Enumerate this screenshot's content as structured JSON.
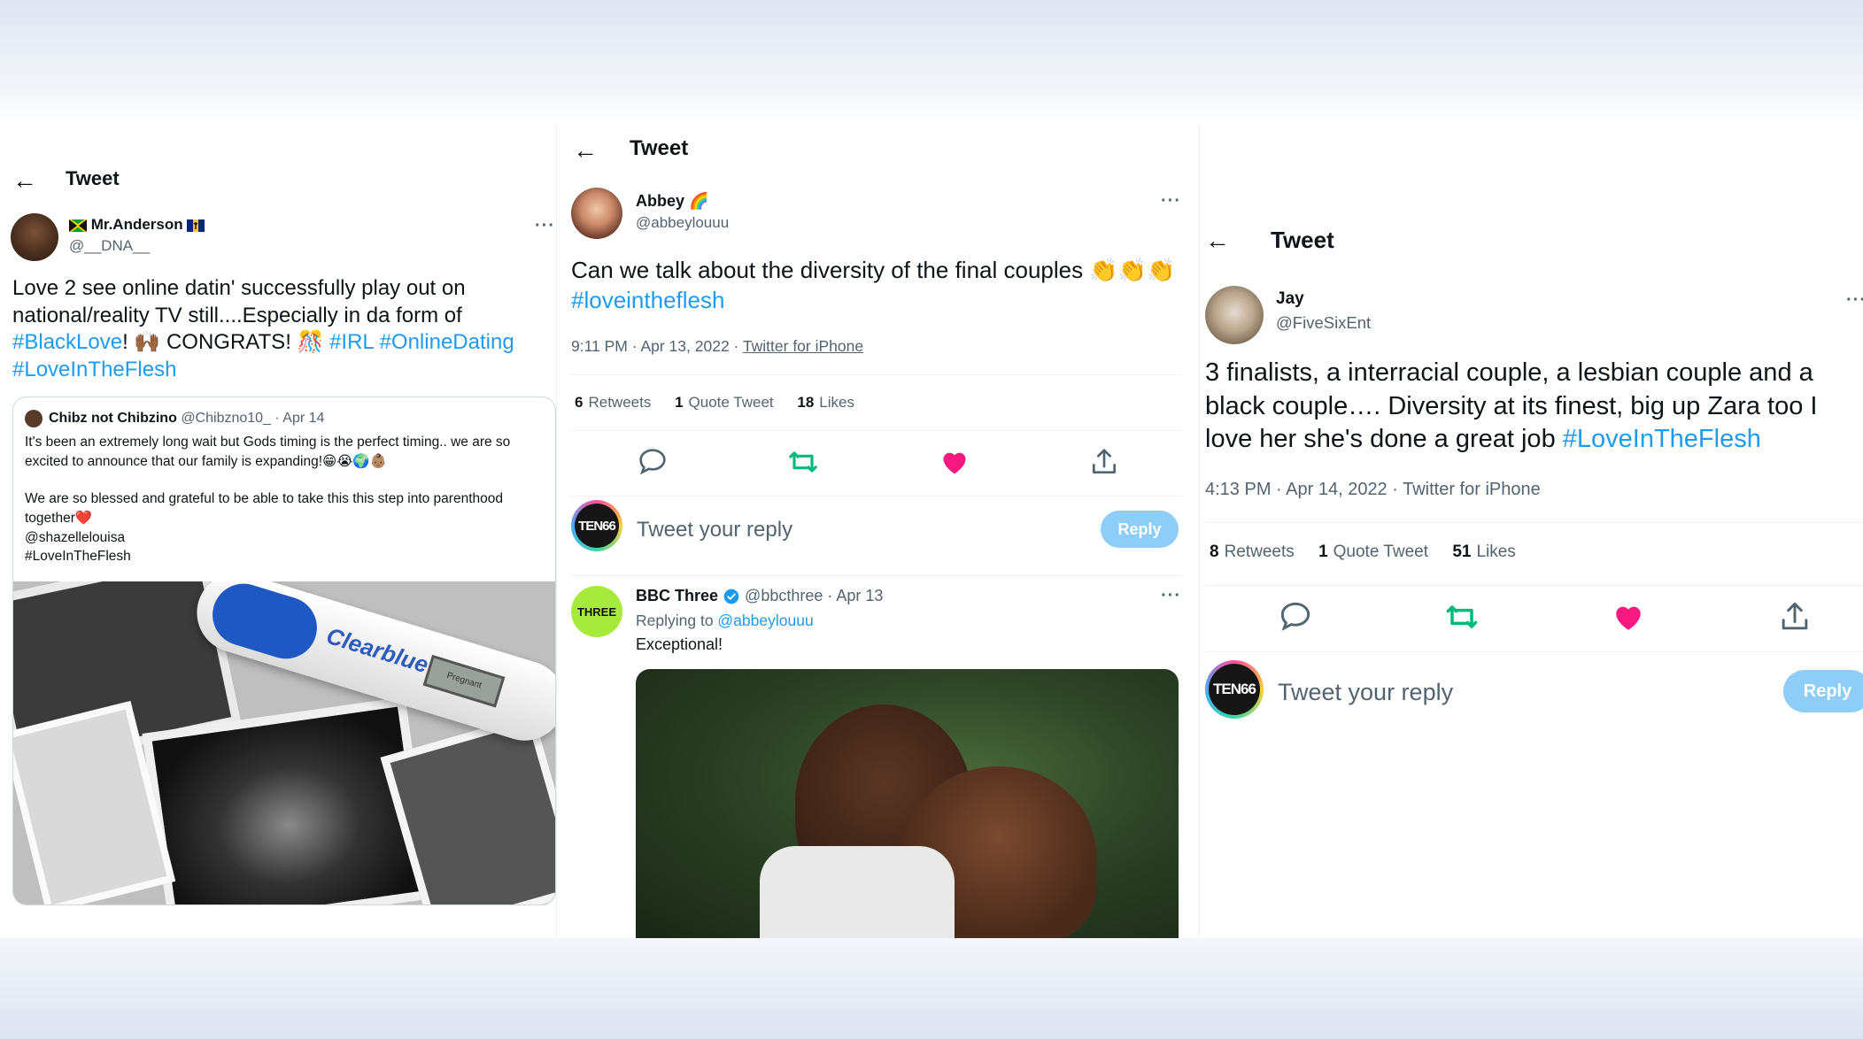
{
  "panels": [
    {
      "header_title": "Tweet",
      "author": {
        "name": "Mr.Anderson",
        "handle": "@__DNA__"
      },
      "text_parts": [
        {
          "t": "Love 2 see online datin' successfully play out on national/reality TV still....Especially in da form of ",
          "tag": false
        },
        {
          "t": "#BlackLove",
          "tag": true
        },
        {
          "t": "! 🙌🏾 CONGRATS! 🎊 ",
          "tag": false
        },
        {
          "t": "#IRL",
          "tag": true
        },
        {
          "t": " ",
          "tag": false
        },
        {
          "t": "#OnlineDating",
          "tag": true
        },
        {
          "t": " ",
          "tag": false
        },
        {
          "t": "#LoveInTheFlesh",
          "tag": true
        }
      ],
      "quote": {
        "name": "Chibz not Chibzino",
        "handle": "@Chibzno10_",
        "date": "· Apr 14",
        "line1": "It's been an extremely long wait but Gods timing is the perfect timing.. we are so excited to announce that our family is expanding!😁😭🌍👶🏽",
        "line2": "We are so blessed and grateful to be able to take this this step into parenthood together❤️",
        "line3": "@shazellelouisa",
        "line4": "#LoveInTheFlesh",
        "image_brand": "Clearblue",
        "image_window": "Pregnant"
      }
    },
    {
      "header_title": "Tweet",
      "author": {
        "name": "Abbey 🌈",
        "handle": "@abbeylouuu"
      },
      "text_parts": [
        {
          "t": "Can we talk about the diversity of the final couples 👏👏👏 ",
          "tag": false
        },
        {
          "t": "#loveintheflesh",
          "tag": true
        }
      ],
      "meta_time": "9:11 PM · Apr 13, 2022 · ",
      "meta_source": "Twitter for iPhone",
      "stats": [
        {
          "n": "6",
          "label": "Retweets"
        },
        {
          "n": "1",
          "label": "Quote Tweet"
        },
        {
          "n": "18",
          "label": "Likes"
        }
      ],
      "reply_avatar": "TEN66",
      "reply_placeholder": "Tweet your reply",
      "reply_button": "Reply",
      "reply_tweet": {
        "name": "BBC Three",
        "handle": "@bbcthree",
        "date": "· Apr 13",
        "replying_prefix": "Replying to ",
        "replying_handle": "@abbeylouuu",
        "text": "Exceptional!",
        "avatar_text": "THREE"
      }
    },
    {
      "header_title": "Tweet",
      "author": {
        "name": "Jay",
        "handle": "@FiveSixEnt"
      },
      "text_parts": [
        {
          "t": "3 finalists, a interracial couple, a lesbian couple and a black couple…. Diversity at its finest, big up Zara too I love her she's done a great job  ",
          "tag": false
        },
        {
          "t": "#LoveInTheFlesh",
          "tag": true
        }
      ],
      "meta_time": "4:13 PM · Apr 14, 2022 · Twitter for iPhone",
      "stats": [
        {
          "n": "8",
          "label": "Retweets"
        },
        {
          "n": "1",
          "label": "Quote Tweet"
        },
        {
          "n": "51",
          "label": "Likes"
        }
      ],
      "reply_avatar": "TEN66",
      "reply_placeholder": "Tweet your reply",
      "reply_button": "Reply"
    }
  ],
  "colors": {
    "link": "#1d9bf0",
    "retweet": "#00ba7c",
    "like": "#f91880",
    "muted": "#536471",
    "reply_button": "#8ecdf8"
  },
  "more_label": "···",
  "back_label": "←"
}
